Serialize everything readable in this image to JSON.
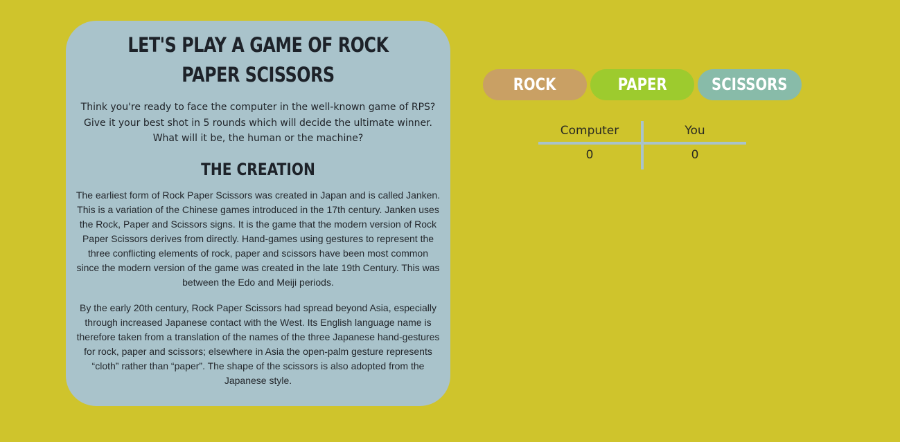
{
  "colors": {
    "page_background": "#cfc42c",
    "card_background": "#a9c3cb",
    "rock": "#c9a064",
    "paper": "#9dcb2e",
    "scissors": "#88bba9",
    "divider": "#a9c3cb"
  },
  "info": {
    "title": "Let's play a game of Rock Paper Scissors",
    "intro": "Think you're ready to face the computer in the well-known game of RPS? Give it your best shot in 5 rounds which will decide the ultimate winner. What will it be, the human or the machine?",
    "section_title": "The Creation",
    "paragraphs": [
      "The earliest form of Rock Paper Scissors was created in Japan and is called Janken. This is a variation of the Chinese games introduced in the 17th century. Janken uses the Rock, Paper and Scissors signs. It is the game that the modern version of Rock Paper Scissors derives from directly. Hand-games using gestures to represent the three conflicting elements of rock, paper and scissors have been most common since the modern version of the game was created in the late 19th Century. This was between the Edo and Meiji periods.",
      "By the early 20th century, Rock Paper Scissors had spread beyond Asia, especially through increased Japanese contact with the West. Its English language name is therefore taken from a translation of the names of the three Japanese hand-gestures for rock, paper and scissors; elsewhere in Asia the open-palm gesture represents “cloth” rather than “paper”. The shape of the scissors is also adopted from the Japanese style."
    ]
  },
  "choices": {
    "rock": "Rock",
    "paper": "Paper",
    "scissors": "Scissors"
  },
  "score": {
    "computer_label": "Computer",
    "you_label": "You",
    "computer_score": "0",
    "you_score": "0"
  }
}
